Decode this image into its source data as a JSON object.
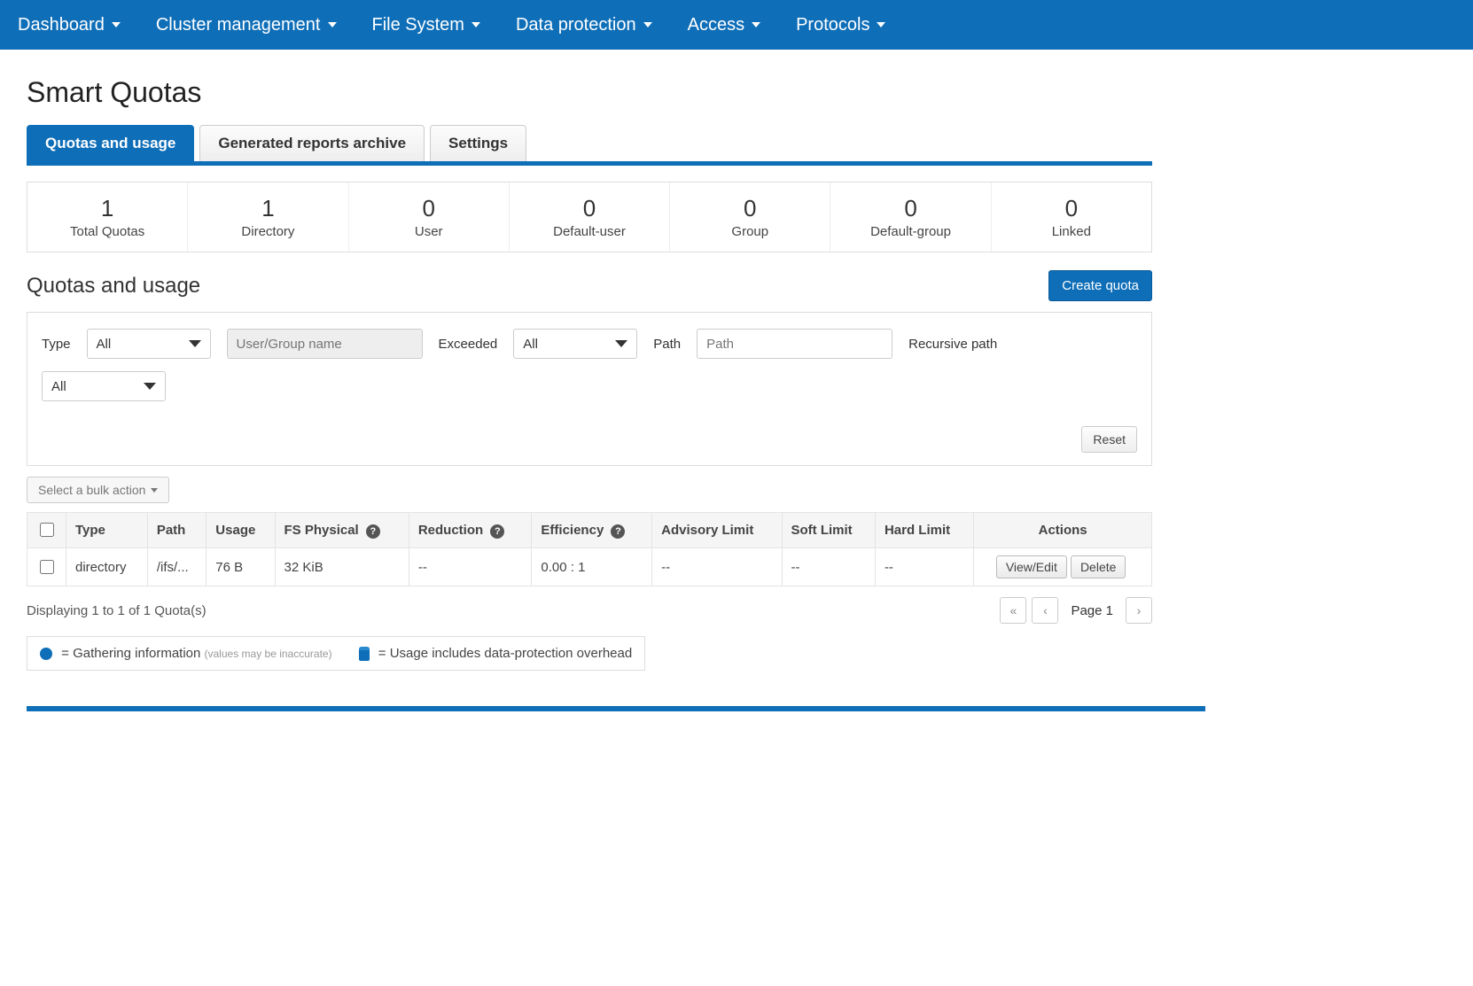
{
  "topnav": [
    {
      "label": "Dashboard"
    },
    {
      "label": "Cluster management"
    },
    {
      "label": "File System"
    },
    {
      "label": "Data protection"
    },
    {
      "label": "Access"
    },
    {
      "label": "Protocols"
    }
  ],
  "page_title": "Smart Quotas",
  "tabs": [
    {
      "label": "Quotas and usage",
      "active": true
    },
    {
      "label": "Generated reports archive",
      "active": false
    },
    {
      "label": "Settings",
      "active": false
    }
  ],
  "stats": [
    {
      "value": "1",
      "label": "Total Quotas"
    },
    {
      "value": "1",
      "label": "Directory"
    },
    {
      "value": "0",
      "label": "User"
    },
    {
      "value": "0",
      "label": "Default-user"
    },
    {
      "value": "0",
      "label": "Group"
    },
    {
      "value": "0",
      "label": "Default-group"
    },
    {
      "value": "0",
      "label": "Linked"
    }
  ],
  "section_title": "Quotas and usage",
  "create_button": "Create quota",
  "filters": {
    "type_label": "Type",
    "type_value": "All",
    "usergroup_placeholder": "User/Group name",
    "exceeded_label": "Exceeded",
    "exceeded_value": "All",
    "path_label": "Path",
    "path_placeholder": "Path",
    "recursive_label": "Recursive path",
    "recursive_value": "All",
    "reset_label": "Reset"
  },
  "bulk_label": "Select a bulk action",
  "table": {
    "headers": {
      "type": "Type",
      "path": "Path",
      "usage": "Usage",
      "fs_physical": "FS Physical",
      "reduction": "Reduction",
      "efficiency": "Efficiency",
      "advisory": "Advisory Limit",
      "soft": "Soft Limit",
      "hard": "Hard Limit",
      "actions": "Actions"
    },
    "row": {
      "type": "directory",
      "path": "/ifs/...",
      "usage": "76 B",
      "fs_physical": "32 KiB",
      "reduction": "--",
      "efficiency": "0.00 : 1",
      "advisory": "--",
      "soft": "--",
      "hard": "--",
      "view_edit": "View/Edit",
      "delete": "Delete"
    }
  },
  "display_text": "Displaying 1 to 1 of 1 Quota(s)",
  "page_label": "Page 1",
  "legend": {
    "gathering": " = Gathering information",
    "gathering_sub": "(values may be inaccurate)",
    "usage_overhead": " = Usage includes data-protection overhead"
  }
}
